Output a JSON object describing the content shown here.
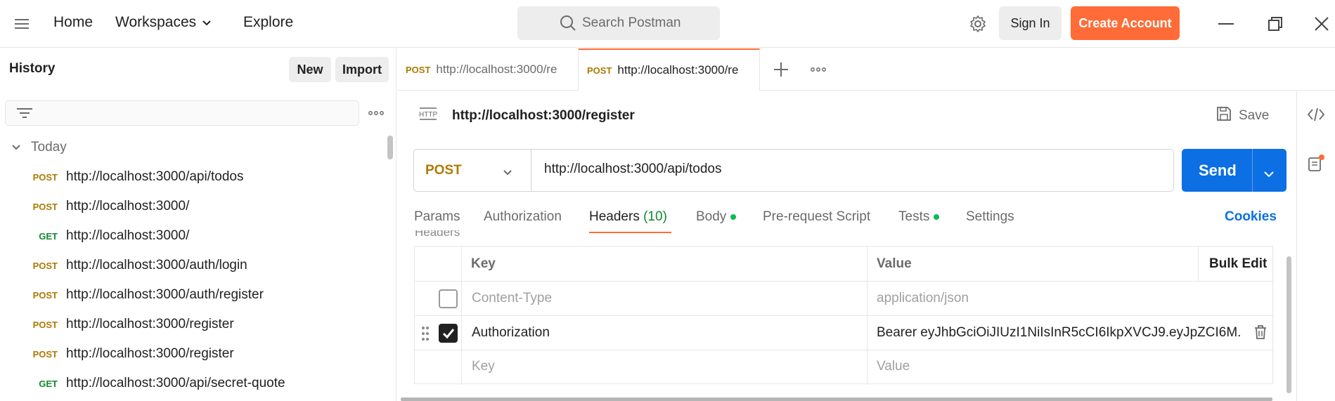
{
  "topbar": {
    "nav": {
      "home": "Home",
      "workspaces": "Workspaces",
      "explore": "Explore"
    },
    "search_placeholder": "Search Postman",
    "sign_in": "Sign In",
    "create_account": "Create Account",
    "accent_color": "#ff6c37"
  },
  "sidebar": {
    "title": "History",
    "new_label": "New",
    "import_label": "Import",
    "group_label": "Today",
    "items": [
      {
        "method": "POST",
        "url": "http://localhost:3000/api/todos"
      },
      {
        "method": "POST",
        "url": "http://localhost:3000/"
      },
      {
        "method": "GET",
        "url": "http://localhost:3000/"
      },
      {
        "method": "POST",
        "url": "http://localhost:3000/auth/login"
      },
      {
        "method": "POST",
        "url": "http://localhost:3000/auth/register"
      },
      {
        "method": "POST",
        "url": "http://localhost:3000/register"
      },
      {
        "method": "POST",
        "url": "http://localhost:3000/register"
      },
      {
        "method": "GET",
        "url": "http://localhost:3000/api/secret-quote"
      }
    ]
  },
  "tabs": [
    {
      "method": "POST",
      "url": "http://localhost:3000/re"
    },
    {
      "method": "POST",
      "url": "http://localhost:3000/re"
    }
  ],
  "request": {
    "badge": "HTTP",
    "title": "http://localhost:3000/register",
    "save_label": "Save",
    "method": "POST",
    "url": "http://localhost:3000/api/todos",
    "send_label": "Send",
    "send_color": "#0c6fe3"
  },
  "request_tabs": {
    "params": "Params",
    "authorization": "Authorization",
    "headers": "Headers",
    "headers_count": "(10)",
    "body": "Body",
    "pre_request": "Pre-request Script",
    "tests": "Tests",
    "settings": "Settings",
    "cookies": "Cookies"
  },
  "headers_table": {
    "partial_label": "Headers",
    "columns": {
      "key": "Key",
      "value": "Value",
      "bulk_edit": "Bulk Edit"
    },
    "rows": [
      {
        "checked": false,
        "key": "Content-Type",
        "value": "application/json"
      },
      {
        "checked": true,
        "key": "Authorization",
        "value": "Bearer eyJhbGciOiJIUzI1NiIsInR5cCI6IkpXVCJ9.eyJpZCI6M..."
      }
    ],
    "empty_row": {
      "key": "Key",
      "value": "Value"
    }
  }
}
